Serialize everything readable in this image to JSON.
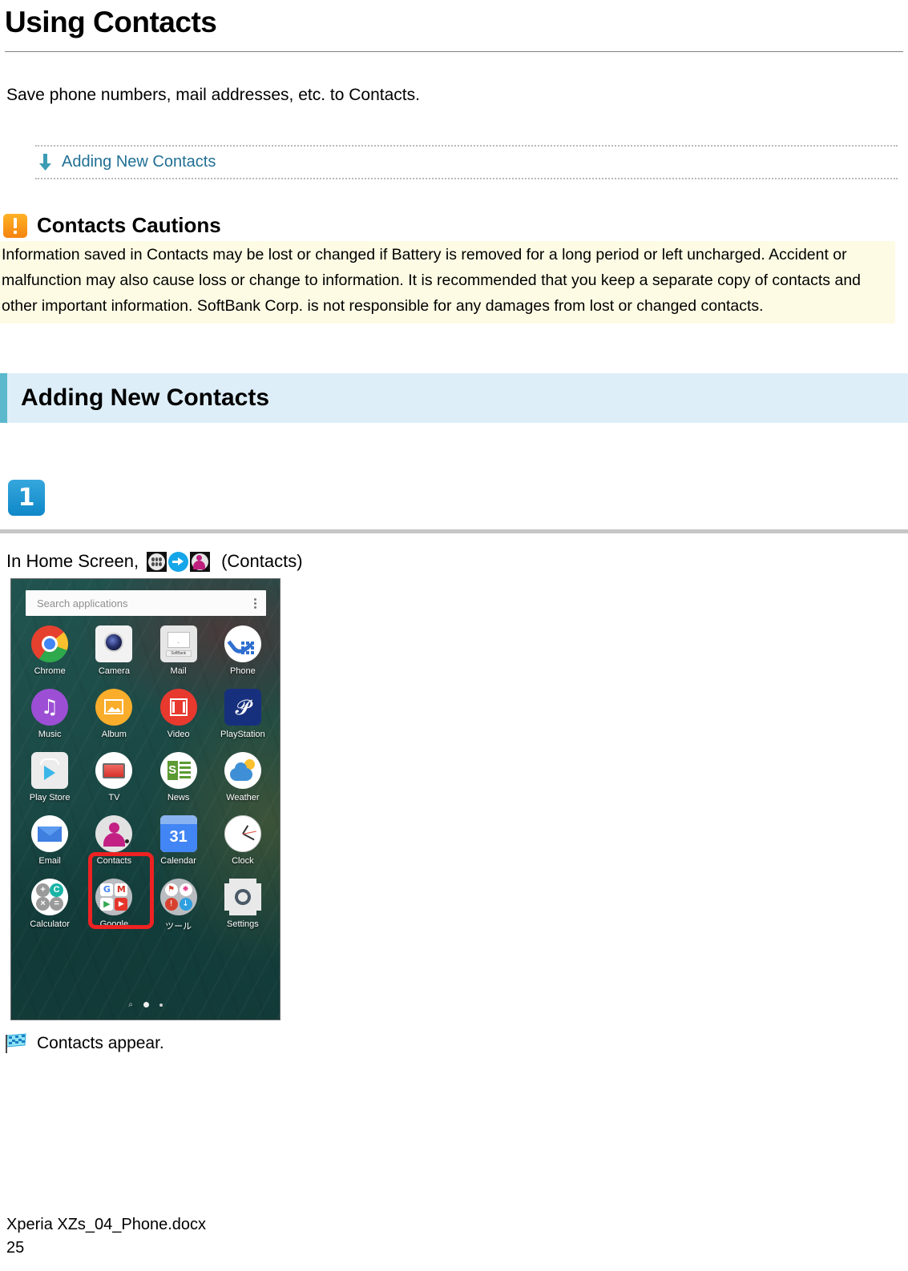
{
  "page": {
    "title": "Using Contacts",
    "intro": "Save phone numbers, mail addresses, etc. to Contacts."
  },
  "jump_links": [
    {
      "label": "Adding New Contacts",
      "icon": "arrow-down-icon",
      "color": "#1f6f94"
    }
  ],
  "caution": {
    "icon": "warning-icon",
    "title": "Contacts Cautions",
    "body": "Information saved in Contacts may be lost or changed if Battery is removed for a long period or left uncharged. Accident or malfunction may also cause loss or change to information. It is recommended that you keep a separate copy of contacts and other important information. SoftBank Corp. is not responsible for any damages from lost or changed contacts.",
    "background": "#fdfbe4"
  },
  "section": {
    "title": "Adding New Contacts",
    "band_color": "#ddeef8",
    "accent_color": "#5cb8cc"
  },
  "step": {
    "number": "1",
    "badge_color": "#0f87c8",
    "text_lead": "In Home Screen,",
    "text_tail": "(Contacts)",
    "icons": [
      "app-drawer-icon",
      "arrow-right-icon",
      "contacts-icon"
    ]
  },
  "phone": {
    "search": {
      "placeholder": "Search applications",
      "overflow_icon": "kebab-menu-icon"
    },
    "apps": [
      {
        "label": "Chrome",
        "icon": "chrome-icon"
      },
      {
        "label": "Camera",
        "icon": "camera-icon"
      },
      {
        "label": "Mail",
        "icon": "mail-icon",
        "badge": "SoftBank"
      },
      {
        "label": "Phone",
        "icon": "phone-icon"
      },
      {
        "label": "Music",
        "icon": "music-icon"
      },
      {
        "label": "Album",
        "icon": "album-icon"
      },
      {
        "label": "Video",
        "icon": "video-icon"
      },
      {
        "label": "PlayStation",
        "icon": "playstation-icon"
      },
      {
        "label": "Play Store",
        "icon": "play-store-icon"
      },
      {
        "label": "TV",
        "icon": "tv-icon"
      },
      {
        "label": "News",
        "icon": "news-icon"
      },
      {
        "label": "Weather",
        "icon": "weather-icon"
      },
      {
        "label": "Email",
        "icon": "email-icon"
      },
      {
        "label": "Contacts",
        "icon": "contacts-icon",
        "highlighted": true
      },
      {
        "label": "Calendar",
        "icon": "calendar-icon",
        "day": "31"
      },
      {
        "label": "Clock",
        "icon": "clock-icon"
      },
      {
        "label": "Calculator",
        "icon": "calculator-icon"
      },
      {
        "label": "Google",
        "icon": "google-folder-icon"
      },
      {
        "label": "ツール",
        "icon": "tools-folder-icon"
      },
      {
        "label": "Settings",
        "icon": "settings-icon"
      }
    ],
    "calculator_glyphs": [
      "+",
      "C",
      "×",
      "="
    ],
    "google_glyphs": [
      "G",
      "M",
      "▶",
      "▶"
    ],
    "highlight_color": "#ee2222",
    "page_indicator": {
      "search_glyph": "⌕",
      "active": 1,
      "total": 2
    }
  },
  "result": {
    "icon": "checkered-flag-icon",
    "text": "Contacts appear."
  },
  "footer": {
    "filename": "Xperia XZs_04_Phone.docx",
    "page_number": "25"
  }
}
